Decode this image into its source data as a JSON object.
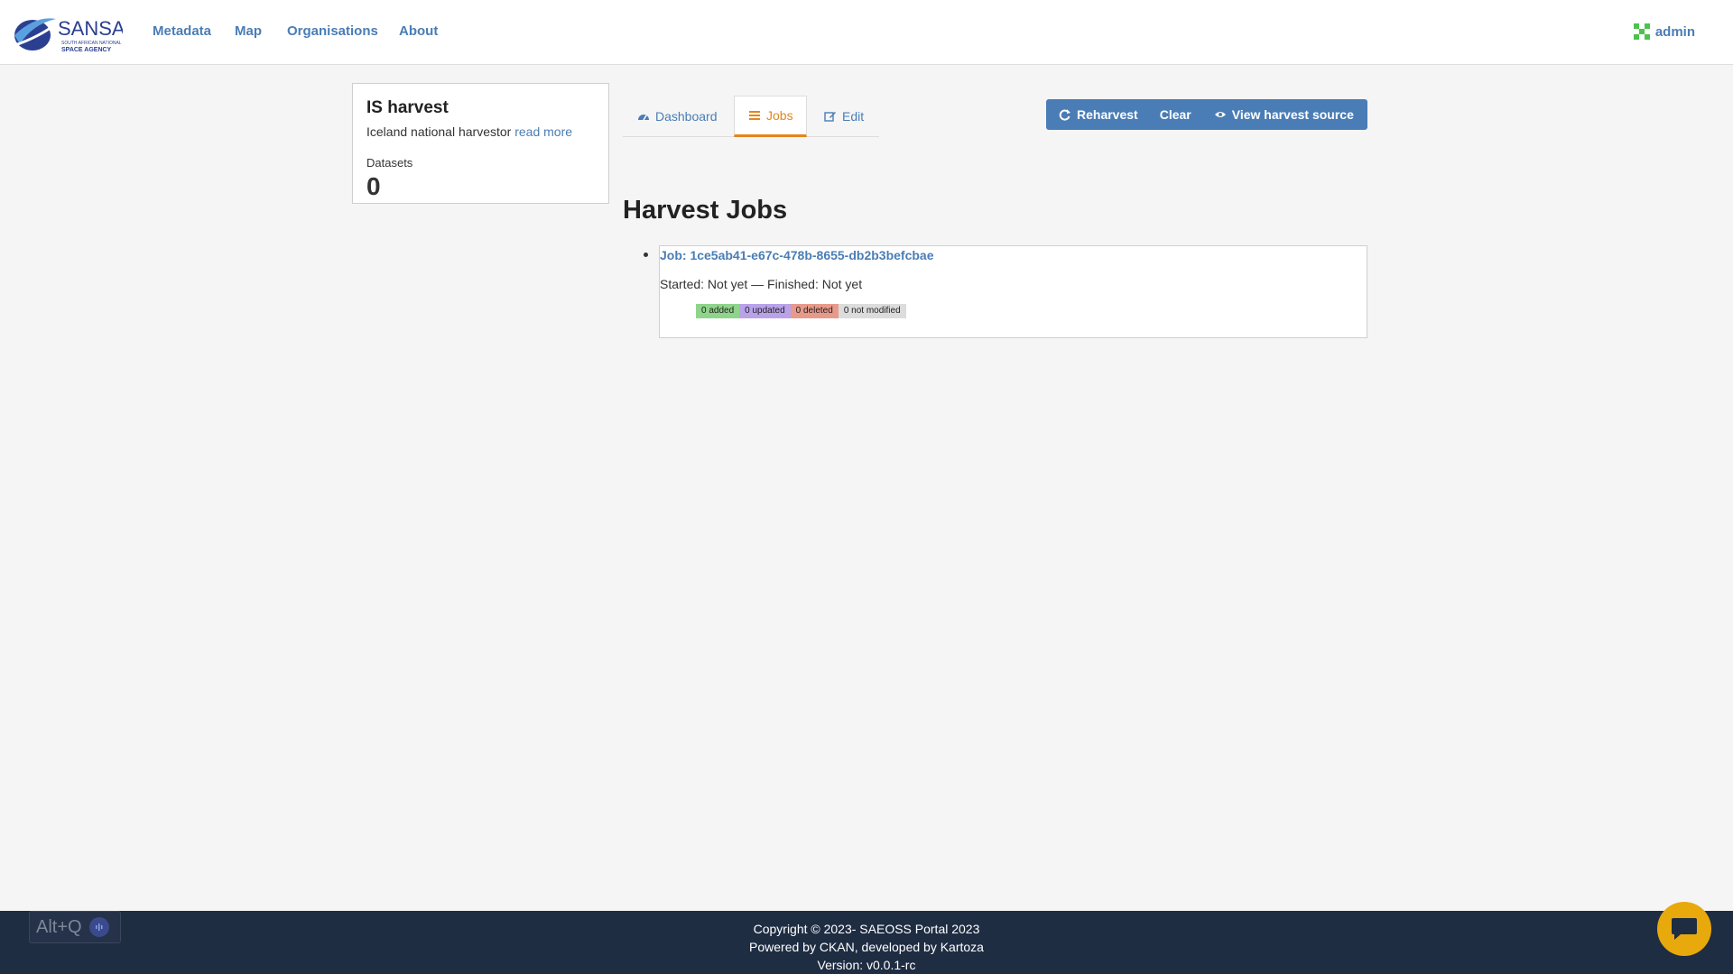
{
  "header": {
    "logo": {
      "text": "SANSA",
      "subtext_1": "SOUTH AFRICAN NATIONAL",
      "subtext_2": "SPACE AGENCY"
    },
    "nav": [
      {
        "label": "Metadata"
      },
      {
        "label": "Map"
      },
      {
        "label": "Organisations"
      },
      {
        "label": "About"
      }
    ],
    "user": {
      "label": "admin"
    }
  },
  "sidebar": {
    "title": "IS harvest",
    "description": "Iceland national harvestor",
    "read_more": "read more",
    "datasets_label": "Datasets",
    "datasets_count": "0"
  },
  "tabs": [
    {
      "label": "Dashboard",
      "icon": "dashboard-icon",
      "active": false
    },
    {
      "label": "Jobs",
      "icon": "list-icon",
      "active": true
    },
    {
      "label": "Edit",
      "icon": "edit-icon",
      "active": false
    }
  ],
  "actions": {
    "reharvest": "Reharvest",
    "clear": "Clear",
    "view_source": "View harvest source"
  },
  "main": {
    "title": "Harvest Jobs",
    "jobs": [
      {
        "link": "Job: 1ce5ab41-e67c-478b-8655-db2b3befcbae",
        "status": "Started: Not yet — Finished: Not yet",
        "badges": {
          "added": "0 added",
          "updated": "0 updated",
          "deleted": "0 deleted",
          "not_modified": "0 not modified"
        }
      }
    ]
  },
  "footer": {
    "line1": "Copyright © 2023- SAEOSS Portal 2023",
    "line2": "Powered by CKAN, developed by Kartoza",
    "line3": "Version: v0.0.1-rc"
  },
  "overlay": {
    "shortcut": "Alt+Q"
  },
  "colors": {
    "accent": "#4a7db5",
    "active_tab": "#e2861d",
    "footer_bg": "#1f2d43",
    "chat_button": "#e8a90d"
  }
}
